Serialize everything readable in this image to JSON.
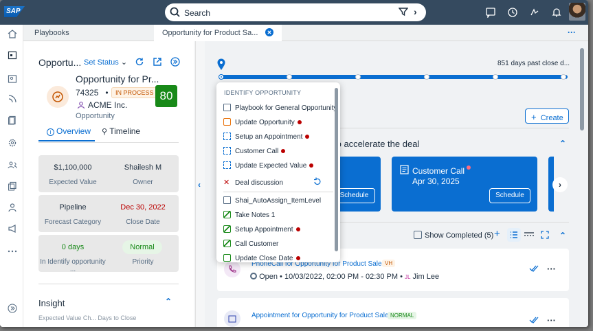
{
  "shell": {
    "logo": "SAP",
    "search_placeholder": "Search"
  },
  "tabs": [
    {
      "label": "Playbooks"
    },
    {
      "label": "Opportunity for Product Sa..."
    }
  ],
  "left": {
    "header": "Opportu...",
    "set_status": "Set Status",
    "object_title": "Opportunity for Pr...",
    "object_number": "74325",
    "status_badge": "IN PROCESS",
    "account": "ACME Inc.",
    "object_type": "Opportunity",
    "score": "80",
    "tab_overview": "Overview",
    "tab_timeline": "Timeline",
    "cards": [
      {
        "v1": "$1,100,000",
        "l1": "Expected Value",
        "v2": "Shailesh M",
        "l2": "Owner"
      },
      {
        "v1": "Pipeline",
        "l1": "Forecast Category",
        "v2": "Dec 30, 2022",
        "l2": "Close Date"
      },
      {
        "v1": "0 days",
        "l1": "In Identify opportunity ...",
        "v2": "Normal",
        "l2": "Priority"
      }
    ],
    "insight": "Insight",
    "insight_sub": "Expected Value Ch...         Days to Close"
  },
  "main": {
    "days_past": "851 days past close d...",
    "create": "Create",
    "accelerate": "to accelerate the deal",
    "blue_cards": [
      {
        "title": "",
        "date": "",
        "schedule": "Schedule"
      },
      {
        "title": "Customer Call",
        "date": "Apr 30, 2025",
        "schedule": "Schedule"
      }
    ],
    "show_completed": "Show Completed (5)",
    "activities": [
      {
        "title": "PhoneCall for Opportunity for Product Sales",
        "badge": "VH",
        "status": "Open",
        "time": "10/03/2022, 02:00 PM - 02:30 PM",
        "initials": "JL",
        "person": "Jim Lee"
      },
      {
        "title": "Appointment for Opportunity for Product Sales",
        "badge": "NORMAL"
      }
    ]
  },
  "popover": {
    "header": "IDENTIFY OPPORTUNITY",
    "items": [
      {
        "label": "Playbook for General Opportunity"
      },
      {
        "label": "Update Opportunity"
      },
      {
        "label": "Setup an Appointment"
      },
      {
        "label": "Customer Call"
      },
      {
        "label": "Update Expected Value"
      },
      {
        "label": "Deal discussion"
      },
      {
        "label": "Shai_AutoAssign_ItemLevel"
      },
      {
        "label": "Take Notes 1"
      },
      {
        "label": "Setup Appointment"
      },
      {
        "label": "Call Customer"
      },
      {
        "label": "Update Close Date"
      }
    ]
  }
}
